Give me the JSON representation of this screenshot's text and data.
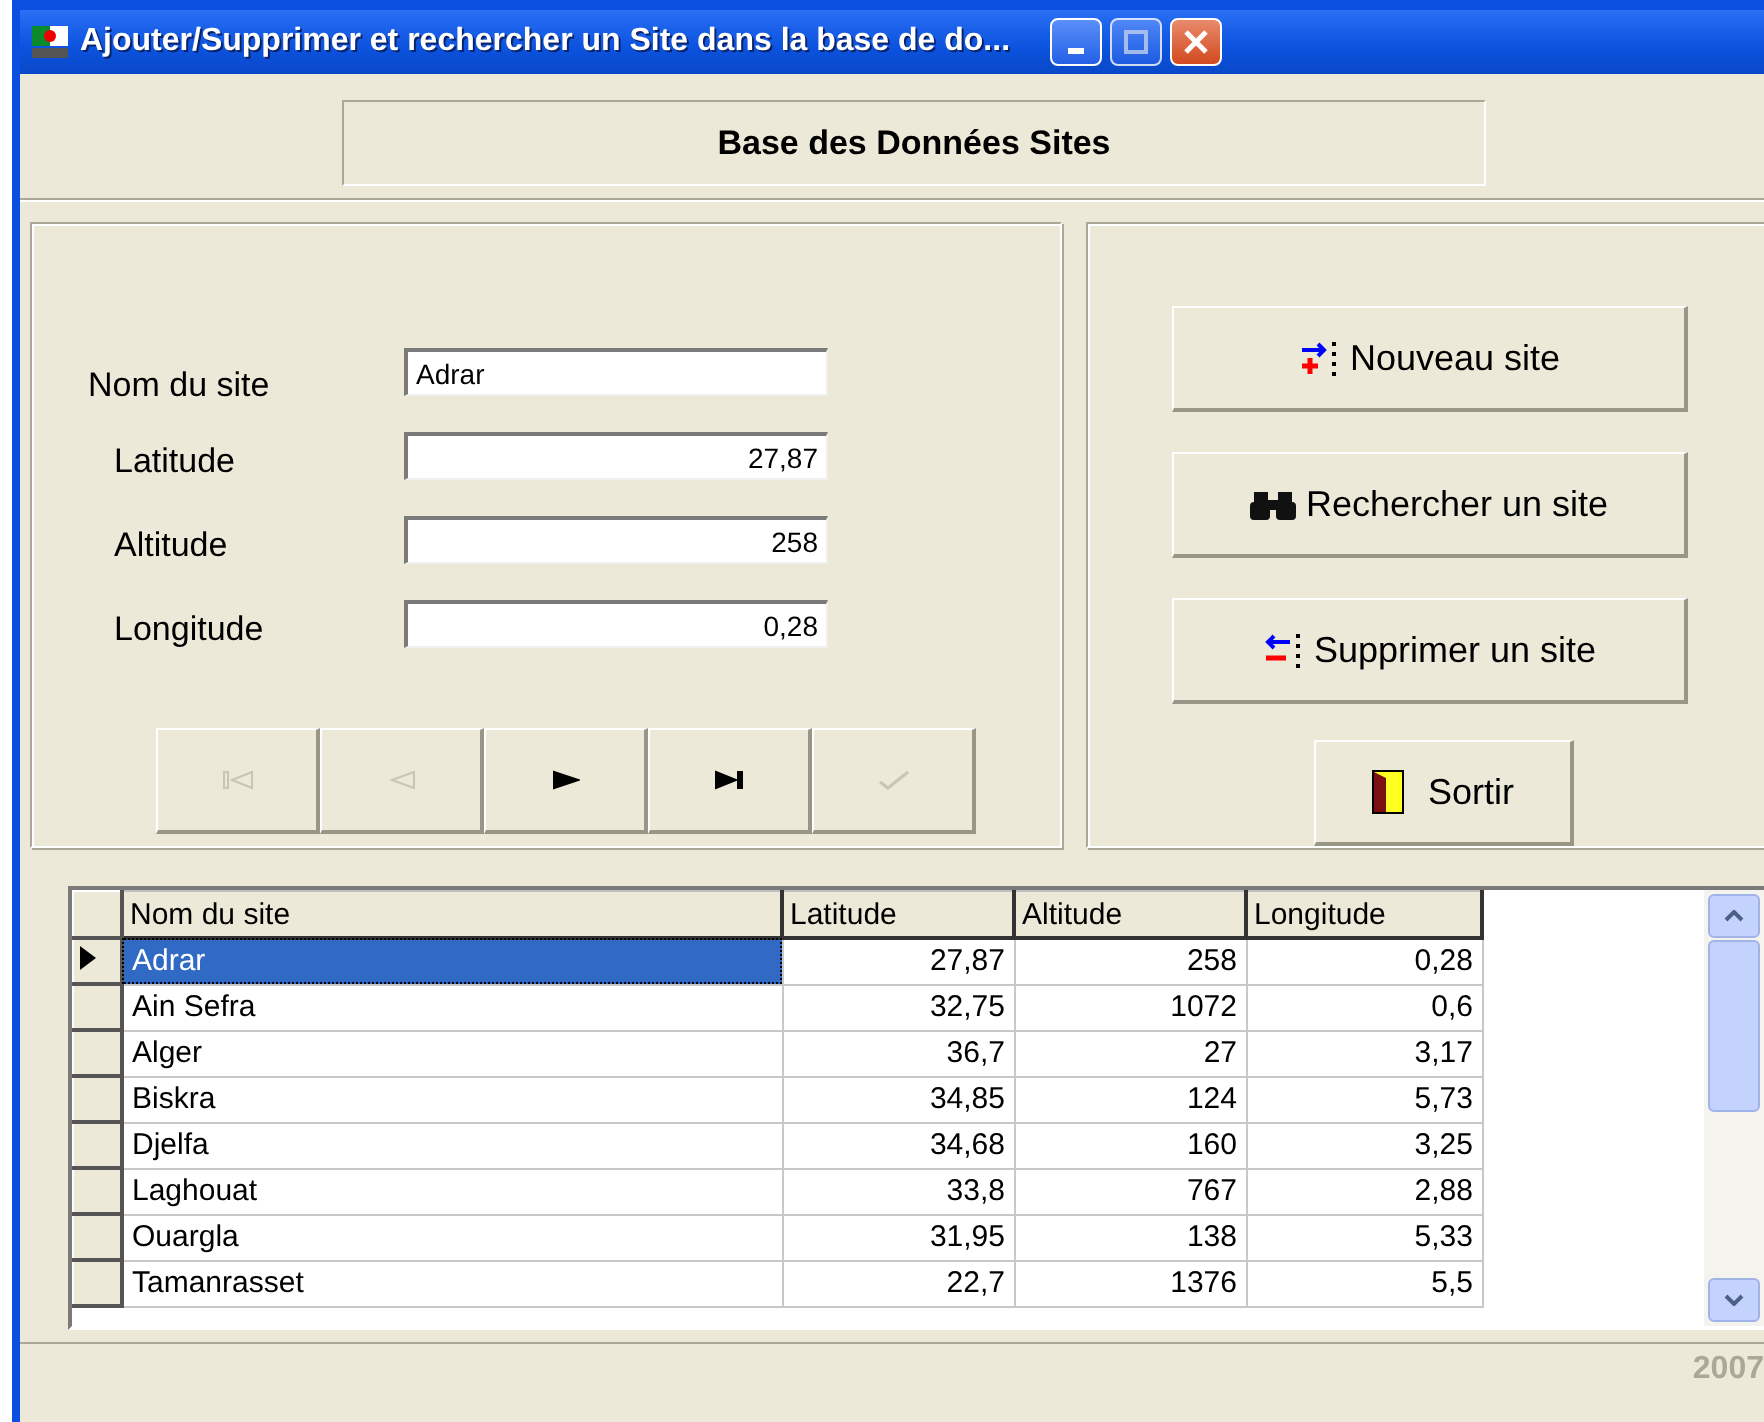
{
  "window": {
    "title": "Ajouter/Supprimer et rechercher  un Site dans la base de do..."
  },
  "header": {
    "title": "Base des Données Sites"
  },
  "form": {
    "fields": [
      {
        "label": "Nom du site",
        "value": "Adrar",
        "kind": "text"
      },
      {
        "label": "Latitude",
        "value": "27,87",
        "kind": "number"
      },
      {
        "label": "Altitude",
        "value": "258",
        "kind": "number"
      },
      {
        "label": "Longitude",
        "value": "0,28",
        "kind": "number"
      }
    ]
  },
  "navigator": [
    {
      "kind": "first",
      "disabled": true
    },
    {
      "kind": "prior",
      "disabled": true
    },
    {
      "kind": "next",
      "disabled": false
    },
    {
      "kind": "last",
      "disabled": false
    },
    {
      "kind": "post",
      "disabled": true
    }
  ],
  "actions": [
    {
      "kind": "new",
      "label": "Nouveau site"
    },
    {
      "kind": "search",
      "label": "Rechercher un site"
    },
    {
      "kind": "delete",
      "label": "Supprimer un site"
    },
    {
      "kind": "exit",
      "label": "Sortir"
    }
  ],
  "table": {
    "columns": [
      "Nom du site",
      "Latitude",
      "Altitude",
      "Longitude"
    ],
    "rows": [
      {
        "cells": [
          "Adrar",
          "27,87",
          "258",
          "0,28"
        ],
        "selected": true
      },
      {
        "cells": [
          "Ain Sefra",
          "32,75",
          "1072",
          "0,6"
        ],
        "selected": false
      },
      {
        "cells": [
          "Alger",
          "36,7",
          "27",
          "3,17"
        ],
        "selected": false
      },
      {
        "cells": [
          "Biskra",
          "34,85",
          "124",
          "5,73"
        ],
        "selected": false
      },
      {
        "cells": [
          "Djelfa",
          "34,68",
          "160",
          "3,25"
        ],
        "selected": false
      },
      {
        "cells": [
          "Laghouat",
          "33,8",
          "767",
          "2,88"
        ],
        "selected": false
      },
      {
        "cells": [
          "Ouargla",
          "31,95",
          "138",
          "5,33"
        ],
        "selected": false
      },
      {
        "cells": [
          "Tamanrasset",
          "22,7",
          "1376",
          "5,5"
        ],
        "selected": false
      }
    ]
  },
  "status_bar": {
    "text": "2007"
  }
}
